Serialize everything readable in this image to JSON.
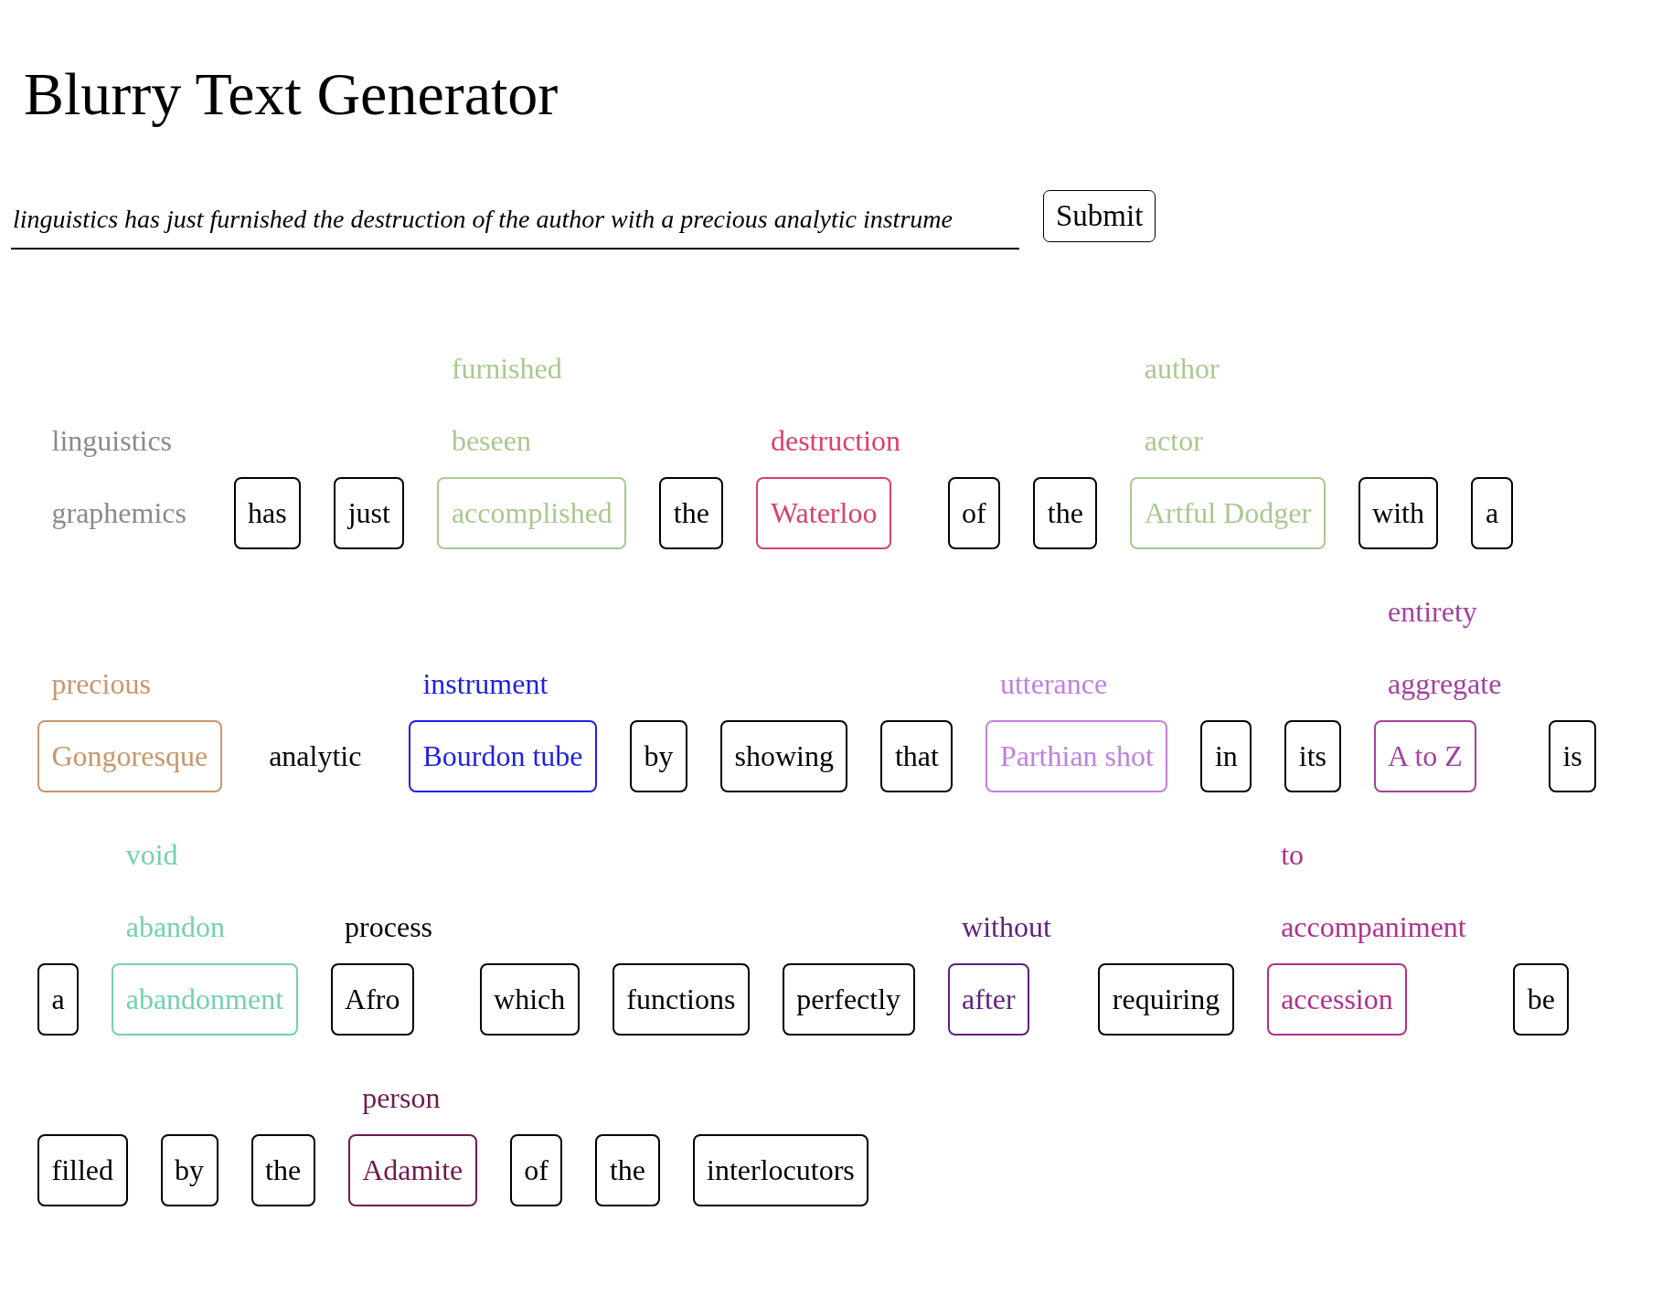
{
  "title": "Blurry Text Generator",
  "form": {
    "input": {
      "value": "linguistics has just furnished the destruction of the author with a precious analytic instrume"
    },
    "submit": "Submit"
  },
  "rows": [
    {
      "tokens": [
        {
          "word": "graphemics",
          "history": [
            "linguistics"
          ],
          "boxed": false,
          "color": "#8a8a8a"
        },
        {
          "word": "has",
          "boxed": true,
          "color": "#000000"
        },
        {
          "word": "just",
          "boxed": true,
          "color": "#000000"
        },
        {
          "word": "accomplished",
          "history": [
            "furnished",
            "beseen"
          ],
          "boxed": true,
          "color": "#a9c98f"
        },
        {
          "word": "the",
          "boxed": true,
          "color": "#000000"
        },
        {
          "word": "Waterloo",
          "history": [
            "destruction"
          ],
          "boxed": true,
          "color": "#d9406c"
        },
        {
          "word": "of",
          "boxed": true,
          "color": "#000000"
        },
        {
          "word": "the",
          "boxed": true,
          "color": "#000000"
        },
        {
          "word": "Artful Dodger",
          "history": [
            "author",
            "actor"
          ],
          "boxed": true,
          "color": "#a9c98f"
        },
        {
          "word": "with",
          "boxed": true,
          "color": "#000000"
        },
        {
          "word": "a",
          "boxed": true,
          "color": "#000000"
        }
      ]
    },
    {
      "tokens": [
        {
          "word": "Gongoresque",
          "history": [
            "precious"
          ],
          "boxed": true,
          "color": "#c9956b"
        },
        {
          "word": "analytic",
          "boxed": false,
          "color": "#000000"
        },
        {
          "word": "Bourdon tube",
          "history": [
            "instrument"
          ],
          "boxed": true,
          "color": "#1f1fe6"
        },
        {
          "word": "by",
          "boxed": true,
          "color": "#000000"
        },
        {
          "word": "showing",
          "boxed": true,
          "color": "#000000"
        },
        {
          "word": "that",
          "boxed": true,
          "color": "#000000"
        },
        {
          "word": "Parthian shot",
          "history": [
            "utterance"
          ],
          "boxed": true,
          "color": "#c07fe0"
        },
        {
          "word": "in",
          "boxed": true,
          "color": "#000000"
        },
        {
          "word": "its",
          "boxed": true,
          "color": "#000000"
        },
        {
          "word": "A to Z",
          "history": [
            "entirety",
            "aggregate"
          ],
          "boxed": true,
          "color": "#a3419f"
        },
        {
          "word": "is",
          "boxed": true,
          "color": "#000000"
        }
      ]
    },
    {
      "tokens": [
        {
          "word": "a",
          "boxed": true,
          "color": "#000000"
        },
        {
          "word": "abandonment",
          "history": [
            "void",
            "abandon"
          ],
          "boxed": true,
          "color": "#74d0b0"
        },
        {
          "word": "Afro",
          "history": [
            "process"
          ],
          "boxed": true,
          "color": "#000000"
        },
        {
          "word": "which",
          "boxed": true,
          "color": "#000000"
        },
        {
          "word": "functions",
          "boxed": true,
          "color": "#000000"
        },
        {
          "word": "perfectly",
          "boxed": true,
          "color": "#000000"
        },
        {
          "word": "after",
          "history": [
            "without"
          ],
          "boxed": true,
          "color": "#5f1f7f"
        },
        {
          "word": "requiring",
          "boxed": true,
          "color": "#000000"
        },
        {
          "word": "accession",
          "history": [
            "to",
            "accompaniment"
          ],
          "boxed": true,
          "color": "#b0308c"
        },
        {
          "word": "be",
          "boxed": true,
          "color": "#000000"
        }
      ]
    },
    {
      "tokens": [
        {
          "word": "filled",
          "boxed": true,
          "color": "#000000"
        },
        {
          "word": "by",
          "boxed": true,
          "color": "#000000"
        },
        {
          "word": "the",
          "boxed": true,
          "color": "#000000"
        },
        {
          "word": "Adamite",
          "history": [
            "person"
          ],
          "boxed": true,
          "color": "#701a50"
        },
        {
          "word": "of",
          "boxed": true,
          "color": "#000000"
        },
        {
          "word": "the",
          "boxed": true,
          "color": "#000000"
        },
        {
          "word": "interlocutors",
          "boxed": true,
          "color": "#000000"
        }
      ]
    }
  ]
}
